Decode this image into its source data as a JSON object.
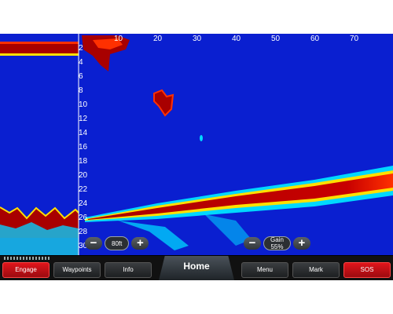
{
  "sonar": {
    "depth_labels": [
      "2",
      "4",
      "6",
      "8",
      "10",
      "12",
      "14",
      "16",
      "18",
      "20",
      "22",
      "24",
      "26",
      "28",
      "30"
    ],
    "range_labels": [
      "10",
      "20",
      "30",
      "40",
      "50",
      "60",
      "70"
    ],
    "colors": {
      "water": "#0a1fd0",
      "strong": "#a80000",
      "medium": "#ff3000",
      "weak": "#ffe000",
      "faint": "#00d8ff"
    }
  },
  "range_control": {
    "minus": "−",
    "value": "80ft",
    "plus": "+"
  },
  "gain_control": {
    "minus": "−",
    "label": "Gain",
    "value": "55%",
    "plus": "+"
  },
  "softkeys": {
    "engage": "Engage",
    "waypoints": "Waypoints",
    "info": "Info",
    "home": "Home",
    "menu": "Menu",
    "mark": "Mark",
    "sos": "SOS"
  }
}
